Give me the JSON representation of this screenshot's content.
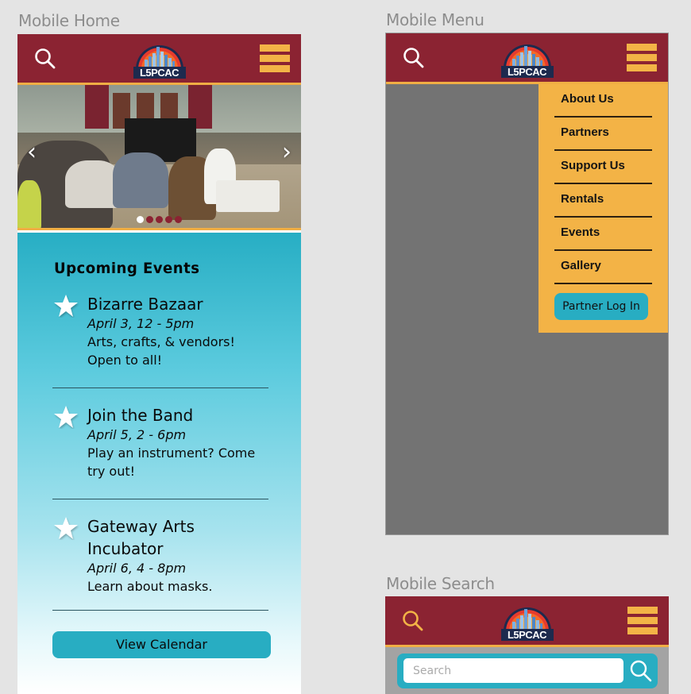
{
  "frames": {
    "home": {
      "label": "Mobile Home"
    },
    "menu": {
      "label": "Mobile Menu"
    },
    "search": {
      "label": "Mobile Search"
    }
  },
  "header": {
    "logo_text": "L5PCAC",
    "search_icon": "search-icon",
    "menu_icon": "hamburger-menu-icon"
  },
  "colors": {
    "header_bg": "#8b2332",
    "accent_gold": "#f3b346",
    "accent_teal": "#28adc2",
    "overlay_gray": "#737373"
  },
  "carousel": {
    "prev_icon": "chevron-left-icon",
    "next_icon": "chevron-right-icon",
    "prev_glyph": "‹",
    "next_glyph": "›",
    "slide_count": 5,
    "active_slide": 1
  },
  "events": {
    "heading": "Upcoming Events",
    "items": [
      {
        "title": "Bizarre Bazaar",
        "date": "April 3, 12 - 5pm",
        "description": "Arts, crafts, & vendors! Open to all!"
      },
      {
        "title": "Join the Band",
        "date": "April 5, 2 - 6pm",
        "description": "Play an instrument? Come try out!"
      },
      {
        "title": "Gateway Arts Incubator",
        "date": "April 6, 4 - 8pm",
        "description": "Learn about masks."
      }
    ],
    "view_calendar_label": "View Calendar"
  },
  "menu": {
    "items": [
      "About Us",
      "Partners",
      "Support Us",
      "Rentals",
      "Events",
      "Gallery"
    ],
    "partner_login_label": "Partner Log In"
  },
  "search": {
    "placeholder": "Search",
    "value": ""
  }
}
